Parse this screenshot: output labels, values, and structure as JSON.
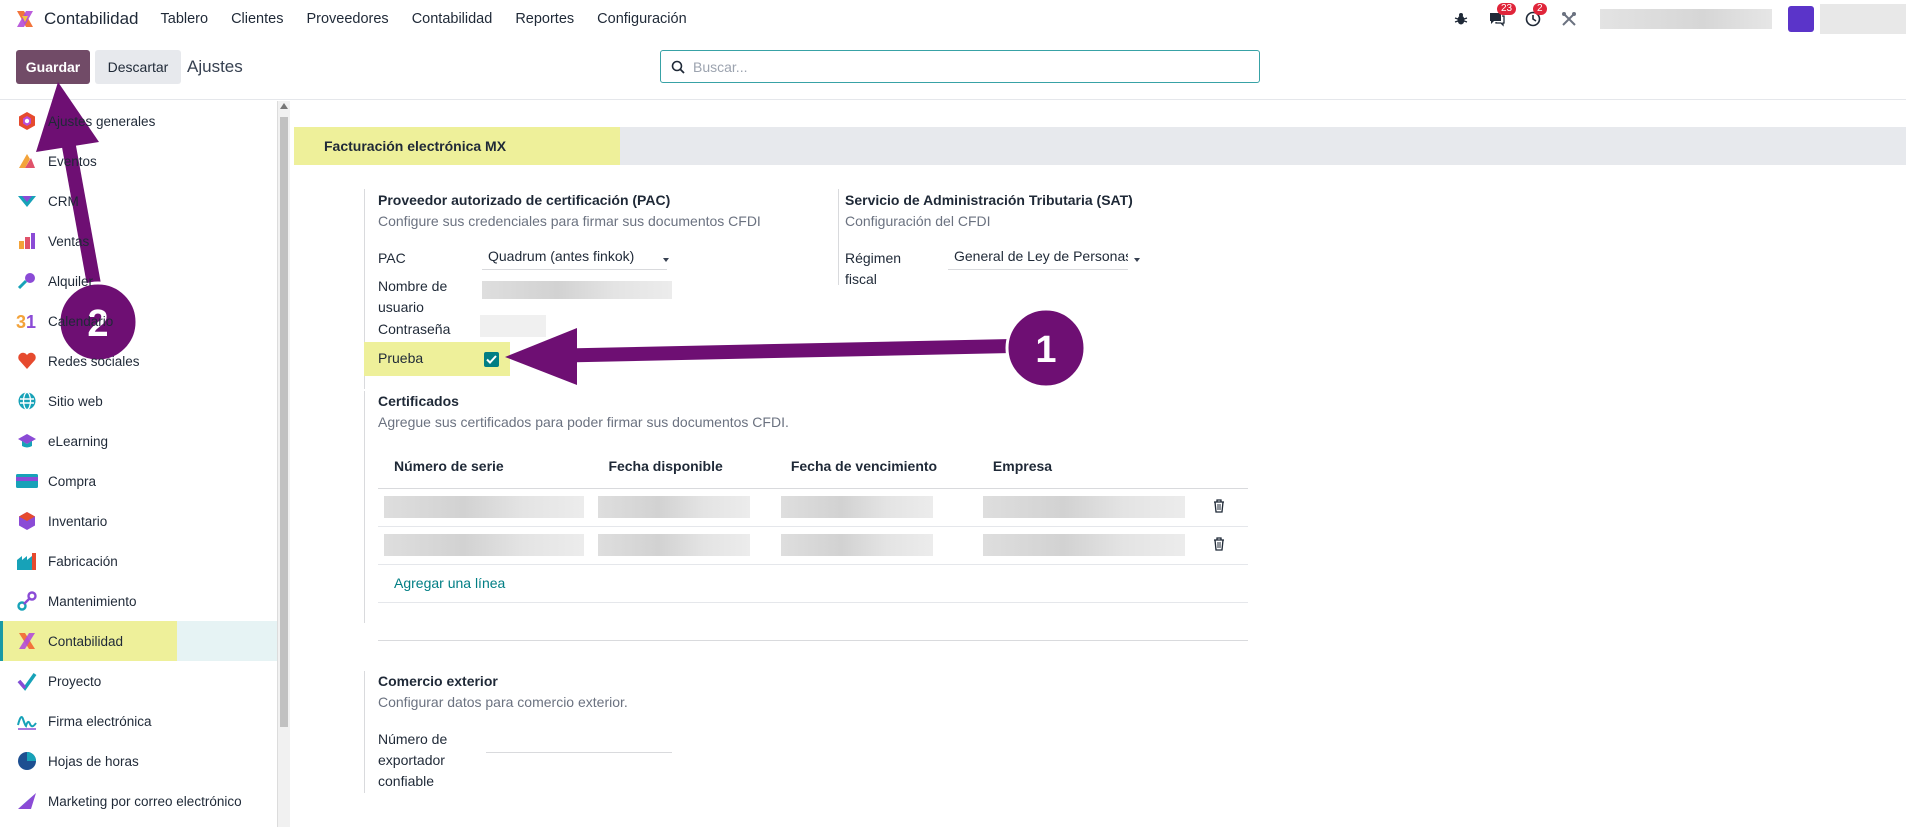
{
  "navbar": {
    "app_name": "Contabilidad",
    "menu": [
      "Tablero",
      "Clientes",
      "Proveedores",
      "Contabilidad",
      "Reportes",
      "Configuración"
    ],
    "messages_badge": "23",
    "activity_badge": "2",
    "icons": [
      "bug-icon",
      "chat-icon",
      "clock-icon",
      "tools-icon"
    ]
  },
  "control": {
    "save_label": "Guardar",
    "discard_label": "Descartar",
    "title": "Ajustes",
    "search_placeholder": "Buscar..."
  },
  "sidebar": {
    "items": [
      {
        "label": "Ajustes generales",
        "icon": "settings-hexagon-icon"
      },
      {
        "label": "Eventos",
        "icon": "events-icon"
      },
      {
        "label": "CRM",
        "icon": "crm-icon"
      },
      {
        "label": "Ventas",
        "icon": "sales-icon"
      },
      {
        "label": "Alquiler",
        "icon": "rental-icon"
      },
      {
        "label": "Calendario",
        "icon": "calendar-icon"
      },
      {
        "label": "Redes sociales",
        "icon": "heart-icon"
      },
      {
        "label": "Sitio web",
        "icon": "website-icon"
      },
      {
        "label": "eLearning",
        "icon": "graduation-cap-icon"
      },
      {
        "label": "Compra",
        "icon": "purchase-icon"
      },
      {
        "label": "Inventario",
        "icon": "inventory-box-icon"
      },
      {
        "label": "Fabricación",
        "icon": "manufacturing-icon"
      },
      {
        "label": "Mantenimiento",
        "icon": "maintenance-icon"
      },
      {
        "label": "Contabilidad",
        "icon": "accounting-icon"
      },
      {
        "label": "Proyecto",
        "icon": "project-check-icon"
      },
      {
        "label": "Firma electrónica",
        "icon": "signature-icon"
      },
      {
        "label": "Hojas de horas",
        "icon": "timesheet-icon"
      },
      {
        "label": "Marketing por correo electrónico",
        "icon": "email-marketing-icon"
      }
    ],
    "active": "Contabilidad"
  },
  "section": {
    "title": "Facturación electrónica MX"
  },
  "pac": {
    "title": "Proveedor autorizado de certificación (PAC)",
    "subtitle": "Configure sus credenciales para firmar sus documentos CFDI",
    "pac_label": "PAC",
    "pac_value": "Quadrum (antes finkok)",
    "username_label": "Nombre de usuario",
    "password_label": "Contraseña",
    "test_label": "Prueba",
    "test_checked": true
  },
  "sat": {
    "title": "Servicio de Administración Tributaria (SAT)",
    "subtitle": "Configuración del CFDI",
    "regime_label": "Régimen fiscal",
    "regime_value": "General de Ley de Personas"
  },
  "certificates": {
    "title": "Certificados",
    "subtitle": "Agregue sus certificados para poder firmar sus documentos CFDI.",
    "columns": [
      "Número de serie",
      "Fecha disponible",
      "Fecha de vencimiento",
      "Empresa"
    ],
    "row_count": 2,
    "add_line": "Agregar una línea"
  },
  "foreign_trade": {
    "title": "Comercio exterior",
    "subtitle": "Configurar datos para comercio exterior.",
    "exporter_label": "Número de exportador confiable"
  },
  "annotations": {
    "callout_1": "1",
    "callout_2": "2",
    "arrow_color": "#6e0f73"
  }
}
